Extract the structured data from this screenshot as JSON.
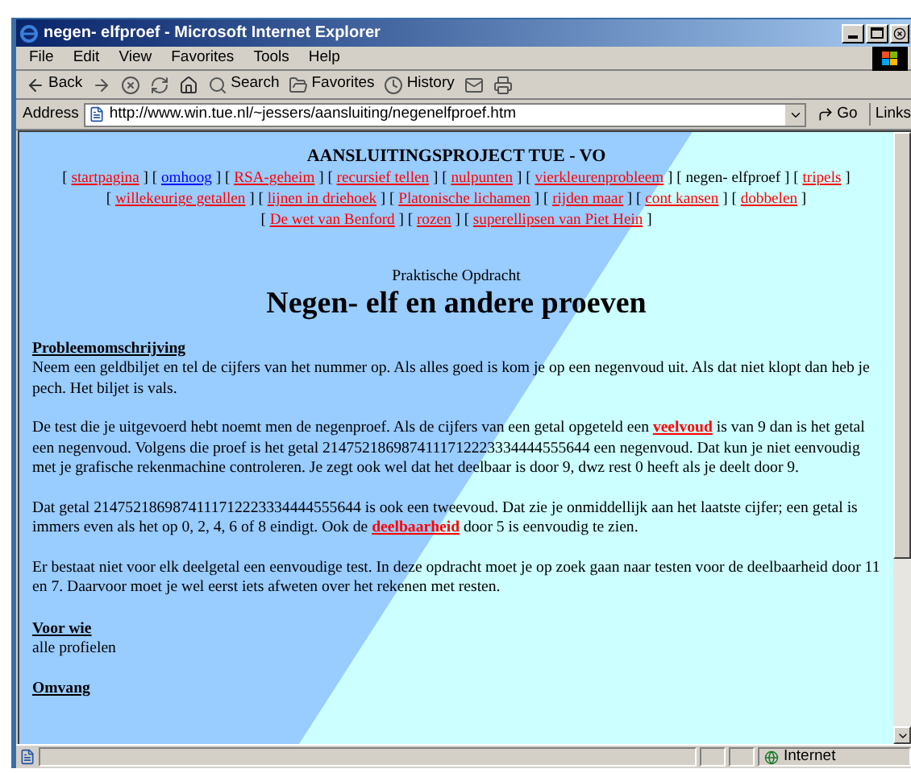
{
  "window": {
    "title": "negen- elfproef - Microsoft Internet Explorer"
  },
  "menu": [
    "File",
    "Edit",
    "View",
    "Favorites",
    "Tools",
    "Help"
  ],
  "toolbar": [
    {
      "kind": "back",
      "label": "Back"
    },
    {
      "kind": "forward"
    },
    {
      "kind": "stop"
    },
    {
      "kind": "refresh"
    },
    {
      "kind": "home"
    },
    {
      "kind": "search",
      "label": "Search"
    },
    {
      "kind": "favorites",
      "label": "Favorites"
    },
    {
      "kind": "history",
      "label": "History"
    },
    {
      "kind": "mail"
    },
    {
      "kind": "print"
    }
  ],
  "address": {
    "label": "Address",
    "url": "http://www.win.tue.nl/~jessers/aansluiting/negenelfproef.htm",
    "go": "Go",
    "links": "Links"
  },
  "page": {
    "header": "AANSLUITINGSPROJECT TUE - VO",
    "nav": [
      [
        {
          "open": "[",
          "text": "startpagina",
          "kind": "link",
          "close": "]"
        },
        {
          "open": "[",
          "text": "omhoog",
          "kind": "visited",
          "close": "]"
        },
        {
          "open": "[",
          "text": "RSA-geheim",
          "kind": "link",
          "close": "]"
        },
        {
          "open": "[",
          "text": "recursief tellen",
          "kind": "link",
          "close": "]"
        },
        {
          "open": "[",
          "text": "nulpunten",
          "kind": "link",
          "close": "]"
        },
        {
          "open": "[",
          "text": "vierkleurenprobleem",
          "kind": "link",
          "close": "]"
        },
        {
          "open": "[",
          "text": "negen- elfproef",
          "kind": "current",
          "close": "]"
        },
        {
          "open": "[",
          "text": "tripels",
          "kind": "link",
          "close": "]"
        }
      ],
      [
        {
          "open": "[",
          "text": "willekeurige getallen",
          "kind": "link",
          "close": "]"
        },
        {
          "open": "[",
          "text": "lijnen in driehoek",
          "kind": "link",
          "close": "]"
        },
        {
          "open": "[",
          "text": "Platonische lichamen",
          "kind": "link",
          "close": "]"
        },
        {
          "open": "[",
          "text": "rijden maar",
          "kind": "link",
          "close": "]"
        },
        {
          "open": "[",
          "text": "cont kansen",
          "kind": "link",
          "close": "]"
        },
        {
          "open": "[",
          "text": "dobbelen",
          "kind": "link",
          "close": "]"
        }
      ],
      [
        {
          "open": "[",
          "text": "De wet van Benford",
          "kind": "link",
          "close": "]"
        },
        {
          "open": "[",
          "text": "rozen",
          "kind": "link",
          "close": "]"
        },
        {
          "open": "[",
          "text": "superellipsen van Piet Hein",
          "kind": "link",
          "close": "]"
        }
      ]
    ],
    "subtitle": "Praktische Opdracht",
    "title": "Negen- elf en andere proeven",
    "sections": [
      {
        "heading": "Probleemomschrijving",
        "paragraphs": [
          [
            {
              "kind": "text",
              "text": "Neem een geldbiljet en tel de cijfers van het nummer op. Als alles goed is kom je op een negenvoud uit. Als dat niet klopt dan heb je pech. Het biljet is vals."
            }
          ],
          [
            {
              "kind": "text",
              "text": "De test die je uitgevoerd hebt noemt men de negenproef. Als de cijfers van een getal opgeteld een "
            },
            {
              "kind": "link",
              "text": "veelvoud"
            },
            {
              "kind": "text",
              "text": " is van 9 dan is het getal een negenvoud. Volgens die proef is het getal 2147521869874111712223334444555644 een negenvoud. Dat kun je niet eenvoudig met je grafische rekenmachine controleren. Je zegt ook wel dat het deelbaar is door 9, dwz rest 0 heeft als je deelt door 9."
            }
          ],
          [
            {
              "kind": "text",
              "text": "Dat getal 2147521869874111712223334444555644 is ook een tweevoud. Dat zie je onmiddellijk aan het laatste cijfer; een getal is immers even als het op 0, 2, 4, 6 of 8 eindigt. Ook de "
            },
            {
              "kind": "link",
              "text": "deelbaarheid"
            },
            {
              "kind": "text",
              "text": " door 5 is eenvoudig te zien."
            }
          ],
          [
            {
              "kind": "text",
              "text": "Er bestaat niet voor elk deelgetal een eenvoudige test. In deze opdracht moet je op zoek gaan naar testen voor de deelbaarheid door 11 en 7. Daarvoor moet je wel eerst iets afweten over het rekenen met resten."
            }
          ]
        ]
      },
      {
        "heading": "Voor wie",
        "paragraphs": [
          [
            {
              "kind": "text",
              "text": "alle profielen"
            }
          ]
        ]
      },
      {
        "heading": "Omvang"
      }
    ]
  },
  "status": {
    "zone": "Internet"
  }
}
